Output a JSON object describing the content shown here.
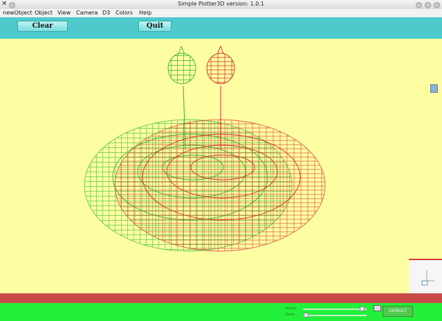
{
  "window": {
    "title": "Simple Plotter3D   version: 1.0.1"
  },
  "menubar": {
    "items": [
      "newObject",
      "Object",
      "View",
      "Camera",
      "D3",
      "Colors",
      "Help"
    ]
  },
  "toolbar": {
    "clear_label": "Clear",
    "quit_label": "Quit"
  },
  "bottom_panel": {
    "slider1_label": "Stereo",
    "slider2_label": "Zoom",
    "slider1_value": 0.92,
    "slider2_value": 0.04,
    "default_label": "DEFAULT"
  },
  "icons": {
    "side_icon": "screen-icon",
    "checkbox": "checkbox-icon"
  },
  "colors": {
    "canvas_bg": "#fdfea2",
    "toolbar_bg": "#4ec9cc",
    "red_strip": "#c84a4a",
    "green_panel": "#22f03a",
    "wire_green": "#2fb52f",
    "wire_red": "#d42a2a"
  }
}
